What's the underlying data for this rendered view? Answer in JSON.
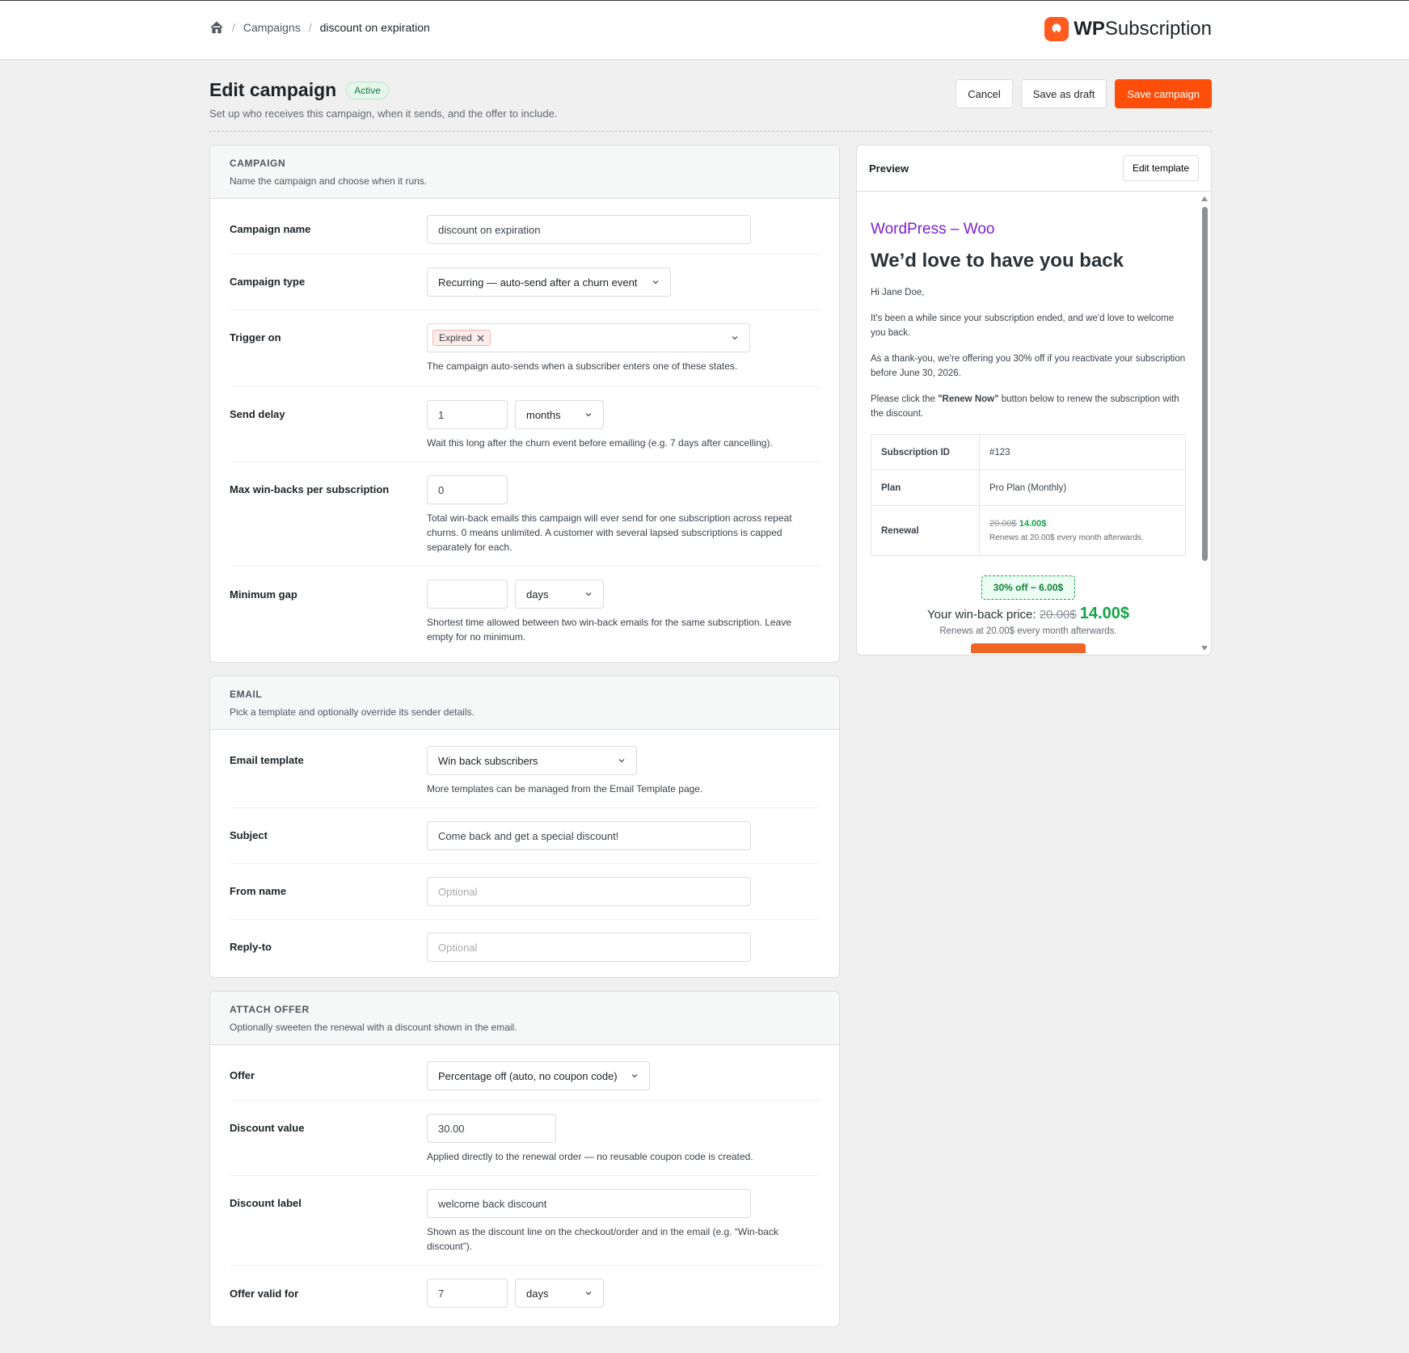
{
  "breadcrumb": {
    "home_icon": "home-icon",
    "campaigns": "Campaigns",
    "current": "discount on expiration"
  },
  "brand": {
    "bold": "WP",
    "rest": "Subscription",
    "accent": "#ff5a1f"
  },
  "header": {
    "title": "Edit campaign",
    "status": "Active",
    "subtitle": "Set up who receives this campaign, when it sends, and the offer to include.",
    "cancel": "Cancel",
    "save_draft": "Save as draft",
    "save_campaign": "Save campaign"
  },
  "campaign": {
    "heading": "CAMPAIGN",
    "description": "Name the campaign and choose when it runs.",
    "name_label": "Campaign name",
    "name_value": "discount on expiration",
    "type_label": "Campaign type",
    "type_value": "Recurring — auto-send after a churn event",
    "trigger_label": "Trigger on",
    "trigger_chip": "Expired",
    "trigger_help": "The campaign auto-sends when a subscriber enters one of these states.",
    "delay_label": "Send delay",
    "delay_value": "1",
    "delay_unit": "months",
    "delay_help": "Wait this long after the churn event before emailing (e.g. 7 days after cancelling).",
    "max_label": "Max win-backs per subscription",
    "max_value": "0",
    "max_help": "Total win-back emails this campaign will ever send for one subscription across repeat churns. 0 means unlimited. A customer with several lapsed subscriptions is capped separately for each.",
    "gap_label": "Minimum gap",
    "gap_value": "",
    "gap_unit": "days",
    "gap_help": "Shortest time allowed between two win-back emails for the same subscription. Leave empty for no minimum."
  },
  "email": {
    "heading": "EMAIL",
    "description": "Pick a template and optionally override its sender details.",
    "template_label": "Email template",
    "template_value": "Win back subscribers",
    "template_help": "More templates can be managed from the Email Template page.",
    "subject_label": "Subject",
    "subject_value": "Come back and get a special discount!",
    "from_label": "From name",
    "from_placeholder": "Optional",
    "reply_label": "Reply-to",
    "reply_placeholder": "Optional"
  },
  "offer": {
    "heading": "ATTACH OFFER",
    "description": "Optionally sweeten the renewal with a discount shown in the email.",
    "offer_label": "Offer",
    "offer_value": "Percentage off (auto, no coupon code)",
    "value_label": "Discount value",
    "value_value": "30.00",
    "value_help": "Applied directly to the renewal order — no reusable coupon code is created.",
    "dlabel_label": "Discount label",
    "dlabel_value": "welcome back discount",
    "dlabel_help": "Shown as the discount line on the checkout/order and in the email (e.g. “Win-back discount”).",
    "valid_label": "Offer valid for",
    "valid_value": "7",
    "valid_unit": "days"
  },
  "preview": {
    "label": "Preview",
    "edit_template": "Edit template",
    "site": "WordPress – Woo",
    "headline": "We’d love to have you back",
    "greeting": "Hi Jane Doe,",
    "p1": "It's been a while since your subscription ended, and we'd love to welcome you back.",
    "p2": "As a thank-you, we're offering you 30% off if you reactivate your subscription before June 30, 2026.",
    "p3_pre": "Please click the ",
    "p3_bold": "\"Renew Now\"",
    "p3_post": " button below to renew the subscription with the discount.",
    "table": [
      {
        "key": "Subscription ID",
        "value": "#123"
      },
      {
        "key": "Plan",
        "value": "Pro Plan (Monthly)"
      }
    ],
    "renewal_key": "Renewal",
    "renewal_old": "20.00$",
    "renewal_new": "14.00$",
    "renewal_note": "Renews at 20.00$ every month afterwards.",
    "discount_pill": "30% off − 6.00$",
    "winback_label": "Your win-back price:",
    "winback_old": "20.00$",
    "winback_new": "14.00$",
    "renews_note": "Renews at 20.00$ every month afterwards."
  }
}
